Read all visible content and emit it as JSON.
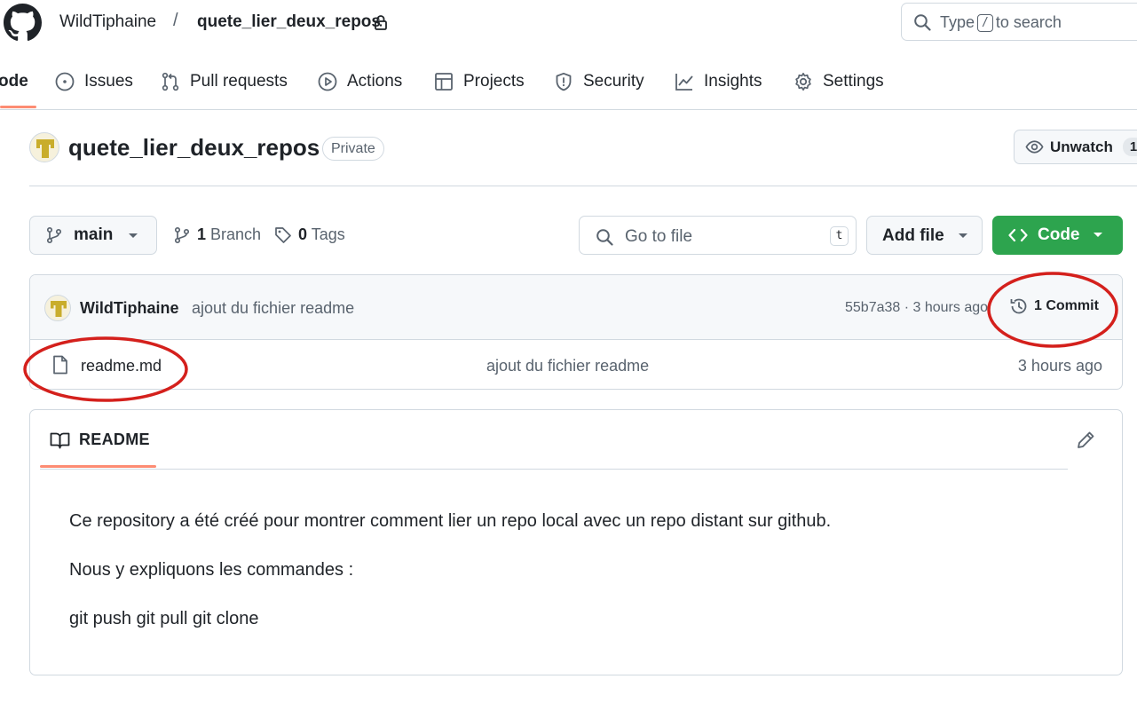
{
  "header": {
    "owner": "WildTiphaine",
    "separator": "/",
    "repo": "quete_lier_deux_repos",
    "search": {
      "before": "Type",
      "key": "/",
      "after": "to search"
    }
  },
  "nav": {
    "tabs": [
      {
        "label": "ode",
        "icon": "code-icon",
        "active": true
      },
      {
        "label": "Issues",
        "icon": "issue-icon"
      },
      {
        "label": "Pull requests",
        "icon": "pull-request-icon"
      },
      {
        "label": "Actions",
        "icon": "play-icon"
      },
      {
        "label": "Projects",
        "icon": "table-icon"
      },
      {
        "label": "Security",
        "icon": "shield-icon"
      },
      {
        "label": "Insights",
        "icon": "graph-icon"
      },
      {
        "label": "Settings",
        "icon": "gear-icon"
      }
    ]
  },
  "repo": {
    "title": "quete_lier_deux_repos",
    "visibility": "Private",
    "watch_label": "Unwatch",
    "watch_count": "1"
  },
  "toolbar": {
    "branch": "main",
    "branches_count": "1",
    "branches_label": "Branch",
    "tags_count": "0",
    "tags_label": "Tags",
    "goto_placeholder": "Go to file",
    "goto_key": "t",
    "add_file": "Add file",
    "code": "Code"
  },
  "latest_commit": {
    "author": "WildTiphaine",
    "message": "ajout du fichier readme",
    "meta": "55b7a38 · 3 hours ago",
    "count_label": "1 Commit"
  },
  "files": [
    {
      "name": "readme.md",
      "message": "ajout du fichier readme",
      "age": "3 hours ago"
    }
  ],
  "readme": {
    "tab": "README",
    "paragraphs": [
      "Ce repository a été créé pour montrer comment lier un repo local avec un repo distant sur github.",
      "Nous y expliquons les commandes :",
      "git push git pull git clone"
    ]
  },
  "colors": {
    "accent_underline": "#fd8c73",
    "code_button": "#2da44e",
    "annotation": "#d4201c"
  }
}
